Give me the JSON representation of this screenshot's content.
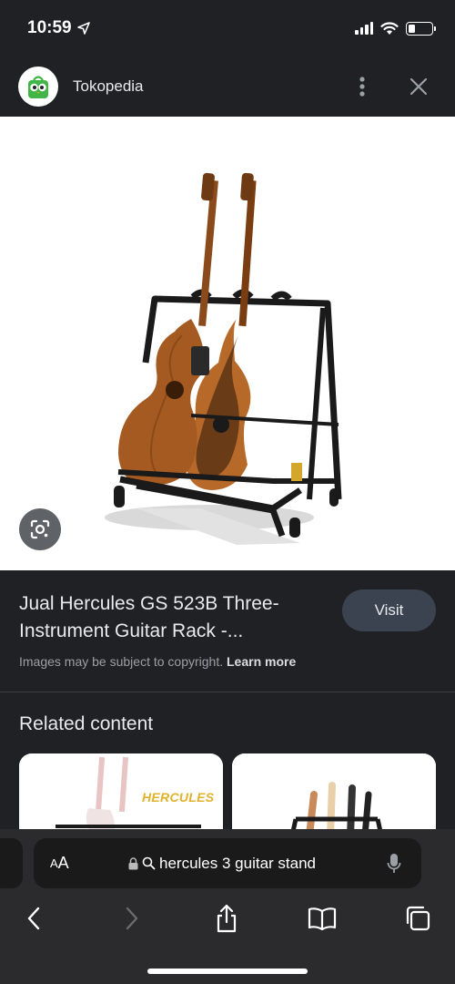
{
  "status_bar": {
    "time": "10:59",
    "icons": [
      "location-arrow-icon",
      "signal-icon",
      "wifi-icon",
      "battery-icon"
    ],
    "battery_level": 0.3
  },
  "site_header": {
    "site_name": "Tokopedia",
    "icons": [
      "tokopedia-logo",
      "more-vert-icon",
      "close-icon"
    ]
  },
  "image_viewer": {
    "lens_icon": "google-lens-icon"
  },
  "result": {
    "title": "Jual Hercules GS 523B Three-Instrument Guitar Rack -...",
    "visit_label": "Visit",
    "copyright_text": "Images may be subject to copyright.",
    "learn_more_label": "Learn more"
  },
  "related": {
    "heading": "Related content",
    "cards": [
      {
        "brand_text": "HERCULES"
      },
      {
        "brand_text": ""
      }
    ]
  },
  "browser": {
    "aa_small": "A",
    "aa_big": "A",
    "url_text": "hercules 3 guitar stand",
    "icons": [
      "lock-icon",
      "search-icon",
      "mic-icon",
      "back-icon",
      "forward-icon",
      "share-icon",
      "bookmarks-icon",
      "tabs-icon"
    ]
  },
  "colors": {
    "background": "#202124",
    "visit_button": "#3c4350",
    "toolbar": "#2b2b2d",
    "hercules_brand": "#e0b22b"
  }
}
